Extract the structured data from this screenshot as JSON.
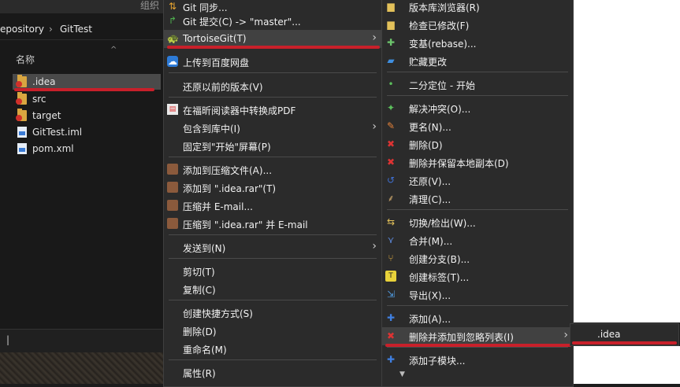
{
  "explorer": {
    "ribbon_label": "组织",
    "address": {
      "part1": "epository",
      "sep": "›",
      "part2": "GitTest"
    },
    "column_name": "名称",
    "sort_indicator": "^",
    "files": [
      {
        "name": ".idea",
        "type": "folder",
        "modified": true,
        "selected": true
      },
      {
        "name": "src",
        "type": "folder",
        "modified": true,
        "selected": false
      },
      {
        "name": "target",
        "type": "folder",
        "modified": true,
        "selected": false
      },
      {
        "name": "GitTest.iml",
        "type": "file",
        "modified": false,
        "selected": false
      },
      {
        "name": "pom.xml",
        "type": "file",
        "modified": false,
        "selected": false
      }
    ],
    "status_caret": "|"
  },
  "context_menu": {
    "items": [
      {
        "label": "Git 同步...",
        "icon": "git-sync-icon"
      },
      {
        "label": "Git 提交(C) -> \"master\"...",
        "icon": "git-commit-icon"
      },
      {
        "label": "TortoiseGit(T)",
        "icon": "tortoise-icon",
        "submenu": true,
        "highlighted": true
      },
      {
        "label": "上传到百度网盘",
        "icon": "baidu-cloud-icon"
      },
      {
        "label": "还原以前的版本(V)",
        "icon": ""
      },
      {
        "label": "在福昕阅读器中转换成PDF",
        "icon": "pdf-icon"
      },
      {
        "label": "包含到库中(I)",
        "icon": "",
        "submenu": true
      },
      {
        "label": "固定到\"开始\"屏幕(P)",
        "icon": ""
      },
      {
        "label": "添加到压缩文件(A)...",
        "icon": "winrar-icon"
      },
      {
        "label": "添加到 \".idea.rar\"(T)",
        "icon": "winrar-icon"
      },
      {
        "label": "压缩并 E-mail...",
        "icon": "winrar-icon"
      },
      {
        "label": "压缩到 \".idea.rar\" 并 E-mail",
        "icon": "winrar-icon"
      },
      {
        "label": "发送到(N)",
        "icon": "",
        "submenu": true
      },
      {
        "label": "剪切(T)",
        "icon": ""
      },
      {
        "label": "复制(C)",
        "icon": ""
      },
      {
        "label": "创建快捷方式(S)",
        "icon": ""
      },
      {
        "label": "删除(D)",
        "icon": ""
      },
      {
        "label": "重命名(M)",
        "icon": ""
      },
      {
        "label": "属性(R)",
        "icon": ""
      }
    ]
  },
  "tortoise_menu": {
    "items": [
      {
        "label": "版本库浏览器(R)",
        "icon": "repo-browser-icon"
      },
      {
        "label": "检查已修改(F)",
        "icon": "check-modified-icon"
      },
      {
        "label": "变基(rebase)...",
        "icon": "rebase-icon"
      },
      {
        "label": "贮藏更改",
        "icon": "stash-icon"
      },
      {
        "label": "二分定位 - 开始",
        "icon": "bisect-icon"
      },
      {
        "label": "解决冲突(O)...",
        "icon": "resolve-icon"
      },
      {
        "label": "更名(N)...",
        "icon": "rename-icon"
      },
      {
        "label": "删除(D)",
        "icon": "delete-icon"
      },
      {
        "label": "删除并保留本地副本(D)",
        "icon": "delete-keep-icon"
      },
      {
        "label": "还原(V)...",
        "icon": "revert-icon"
      },
      {
        "label": "清理(C)...",
        "icon": "cleanup-icon"
      },
      {
        "label": "切换/检出(W)...",
        "icon": "switch-icon"
      },
      {
        "label": "合并(M)...",
        "icon": "merge-icon"
      },
      {
        "label": "创建分支(B)...",
        "icon": "branch-icon"
      },
      {
        "label": "创建标签(T)...",
        "icon": "tag-icon"
      },
      {
        "label": "导出(X)...",
        "icon": "export-icon"
      },
      {
        "label": "添加(A)...",
        "icon": "add-icon"
      },
      {
        "label": "删除并添加到忽略列表(I)",
        "icon": "ignore-icon",
        "submenu": true,
        "highlighted": true
      },
      {
        "label": "添加子模块...",
        "icon": "submodule-icon"
      }
    ]
  },
  "ignore_submenu": {
    "items": [
      {
        "label": ".idea"
      }
    ]
  },
  "colors": {
    "menu_bg": "#2b2b2b",
    "highlight": "#414141",
    "annotation_red": "#c8202a"
  }
}
